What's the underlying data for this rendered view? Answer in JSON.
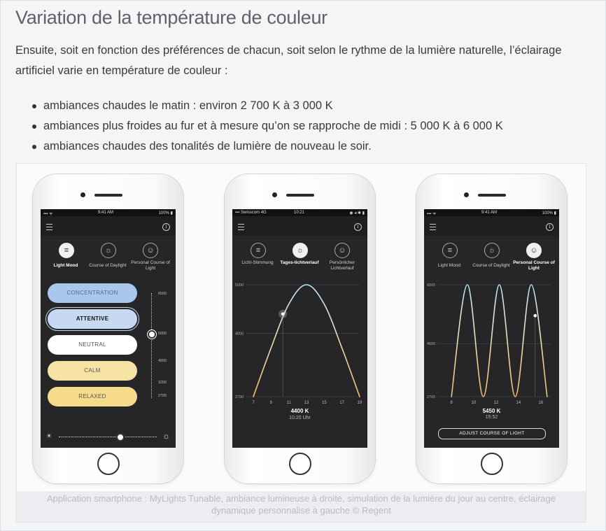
{
  "title": "Variation de la température de couleur",
  "intro": "Ensuite, soit en fonction des préférences de chacun, soit selon le rythme de la lumière naturelle, l’éclairage artificiel varie en température de couleur :",
  "bullets": [
    "ambiances chaudes le matin : environ 2 700 K à 3 000 K",
    "ambiances plus froides au fur et à mesure qu’on se rapproche de midi : 5 000 K à 6 000 K",
    "ambiances chaudes des tonalités de lumière de nouveau le soir."
  ],
  "caption": "Application smartphone : MyLights Tunable, ambiance lumineuse à droite, simulation de la lumière du jour au centre, éclairage dynamique personnalise à gauche © Regent",
  "phone1": {
    "status": {
      "left": "▪▪▪ ᯤ",
      "time": "9:41 AM",
      "right": "100% ▮"
    },
    "tabs": [
      {
        "icon": "sliders-icon",
        "glyph": "≡",
        "label": "Light Mood",
        "active": true
      },
      {
        "icon": "sun-icon",
        "glyph": "☼",
        "label": "Course of Daylight",
        "active": false
      },
      {
        "icon": "person-icon",
        "glyph": "☺",
        "label": "Personal Course of Light",
        "active": false
      }
    ],
    "moods": [
      {
        "label": "CONCENTRATION",
        "color": "#a9c6ec"
      },
      {
        "label": "ATTENTIVE",
        "color": "#c7d9f2"
      },
      {
        "label": "NEUTRAL",
        "color": "#ffffff"
      },
      {
        "label": "CALM",
        "color": "#f7e3a4"
      },
      {
        "label": "RELAXED",
        "color": "#f6dc8a"
      }
    ],
    "ticks": [
      "6500",
      "5000",
      "4000",
      "3200",
      "2700"
    ]
  },
  "phone2": {
    "status": {
      "left": "▪▪▪ Swisscom 4G",
      "time": "10:21",
      "right": "◉ ◂ ✱ ▮"
    },
    "tabs": [
      {
        "icon": "sliders-icon",
        "glyph": "≡",
        "label": "Licht-Stimmung",
        "active": false
      },
      {
        "icon": "sun-icon",
        "glyph": "☼",
        "label": "Tages-lichtverlauf",
        "active": true
      },
      {
        "icon": "person-icon",
        "glyph": "☺",
        "label": "Persönlicher Lichtverlauf",
        "active": false
      }
    ],
    "value": "4400 K",
    "time": "10:20 Uhr"
  },
  "phone3": {
    "status": {
      "left": "▪▪▪ ᯤ",
      "time": "9:41 AM",
      "right": "100% ▮"
    },
    "tabs": [
      {
        "icon": "sliders-icon",
        "glyph": "≡",
        "label": "Light Mood",
        "active": false
      },
      {
        "icon": "sun-icon",
        "glyph": "☼",
        "label": "Course of Daylight",
        "active": false
      },
      {
        "icon": "person-icon",
        "glyph": "☺",
        "label": "Personal Course of Light",
        "active": true
      }
    ],
    "value": "5450 K",
    "time": "15:52",
    "button": "ADJUST COURSE OF LIGHT"
  },
  "chart_data": [
    {
      "type": "line",
      "x": [
        7,
        9,
        11,
        13,
        15,
        17,
        19
      ],
      "series": [
        {
          "values": [
            2700,
            3700,
            4600,
            5000,
            4600,
            3700,
            2700
          ]
        }
      ],
      "y_ticks": [
        "5000",
        "4000",
        "2700"
      ],
      "x_ticks": [
        "7",
        "9",
        "11",
        "13",
        "15",
        "17",
        "19"
      ],
      "ylim": [
        2700,
        5000
      ],
      "marker": {
        "x": 10.33,
        "y": 4400
      }
    },
    {
      "type": "line",
      "x": [
        8,
        9.5,
        11,
        12.5,
        14,
        15.5,
        17
      ],
      "series": [
        {
          "values": [
            2700,
            6500,
            2700,
            6500,
            2700,
            6500,
            2700
          ]
        }
      ],
      "y_ticks": [
        "6500",
        "4500",
        "2700"
      ],
      "x_ticks": [
        "8",
        "10",
        "12",
        "14",
        "16"
      ],
      "ylim": [
        2700,
        6500
      ],
      "marker": {
        "x": 15.87,
        "y": 5450
      }
    }
  ]
}
